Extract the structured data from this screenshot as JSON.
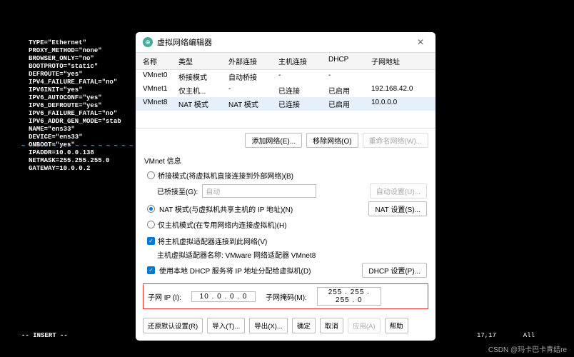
{
  "terminal": {
    "lines": [
      "TYPE=\"Ethernet\"",
      "PROXY_METHOD=\"none\"",
      "BROWSER_ONLY=\"no\"",
      "BOOTPROTO=\"static\"",
      "DEFROUTE=\"yes\"",
      "IPV4_FAILURE_FATAL=\"no\"",
      "IPV6INIT=\"yes\"",
      "IPV6_AUTOCONF=\"yes\"",
      "IPV6_DEFROUTE=\"yes\"",
      "IPV6_FAILURE_FATAL=\"no\"",
      "IPV6_ADDR_GEN_MODE=\"stab",
      "NAME=\"ens33\"",
      "DEVICE=\"ens33\"",
      "ONBOOT=\"yes\"",
      "IPADDR=10.0.0.138",
      "NETMASK=255.255.255.0",
      "GATEWAY=10.0.0.2"
    ],
    "status_left": "-- INSERT --",
    "status_right_pos": "17,17",
    "status_right_mode": "All"
  },
  "dialog": {
    "title": "虚拟网络编辑器",
    "columns": {
      "name": "名称",
      "type": "类型",
      "ext": "外部连接",
      "host": "主机连接",
      "dhcp": "DHCP",
      "subnet": "子网地址"
    },
    "rows": [
      {
        "name": "VMnet0",
        "type": "桥接模式",
        "ext": "自动桥接",
        "host": "-",
        "dhcp": "-",
        "subnet": ""
      },
      {
        "name": "VMnet1",
        "type": "仅主机...",
        "ext": "-",
        "host": "已连接",
        "dhcp": "已启用",
        "subnet": "192.168.42.0"
      },
      {
        "name": "VMnet8",
        "type": "NAT 模式",
        "ext": "NAT 模式",
        "host": "已连接",
        "dhcp": "已启用",
        "subnet": "10.0.0.0"
      }
    ],
    "btns": {
      "add": "添加网络(E)...",
      "remove": "移除网络(O)",
      "rename": "重命名网络(W)..."
    },
    "info_title": "VMnet 信息",
    "opt_bridge": "桥接模式(将虚拟机直接连接到外部网络)(B)",
    "bridge_to_label": "已桥接至(G):",
    "bridge_to_value": "自动",
    "auto_set": "自动设置(U)...",
    "opt_nat": "NAT 模式(与虚拟机共享主机的 IP 地址)(N)",
    "nat_set": "NAT 设置(S)...",
    "opt_hostonly": "仅主机模式(在专用网络内连接虚拟机)(H)",
    "opt_connect_host": "将主机虚拟适配器连接到此网络(V)",
    "host_adapter_label": "主机虚拟适配器名称: VMware 网络适配器 VMnet8",
    "opt_dhcp": "使用本地 DHCP 服务将 IP 地址分配给虚拟机(D)",
    "dhcp_set": "DHCP 设置(P)...",
    "subnet_ip_label": "子网 IP (I):",
    "subnet_ip": "10 . 0 . 0 . 0",
    "mask_label": "子网掩码(M):",
    "mask": "255 . 255 . 255 . 0",
    "footer": {
      "restore": "还原默认设置(R)",
      "import": "导入(T)...",
      "export": "导出(X)...",
      "ok": "确定",
      "cancel": "取消",
      "apply": "应用(A)",
      "help": "帮助"
    }
  },
  "watermark": "CSDN @玛卡巴卡青结re"
}
